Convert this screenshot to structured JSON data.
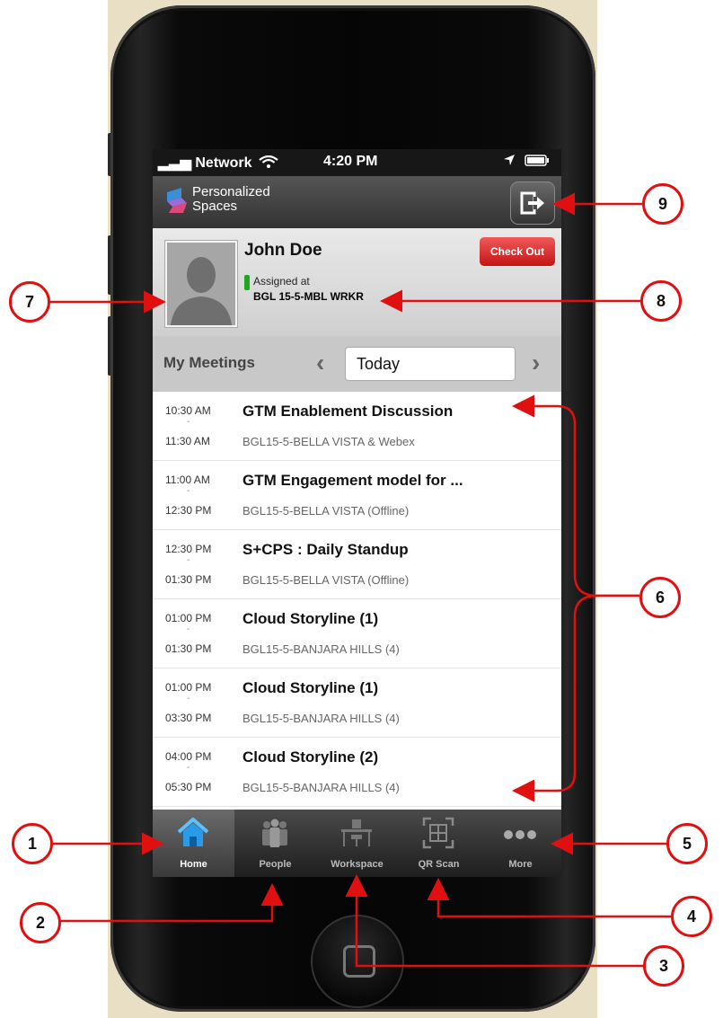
{
  "status_bar": {
    "network": "Network",
    "time": "4:20 PM"
  },
  "app": {
    "name_line1": "Personalized",
    "name_line2": "Spaces"
  },
  "profile": {
    "name": "John Doe",
    "assigned_label": "Assigned at",
    "assigned_value": "BGL 15-5-MBL WRKR",
    "checkout_label": "Check Out"
  },
  "meetings_header": {
    "title": "My Meetings",
    "date_value": "Today"
  },
  "meetings": [
    {
      "start": "10:30 AM",
      "end": "11:30 AM",
      "title": "GTM Enablement Discussion",
      "location": "BGL15-5-BELLA VISTA & Webex"
    },
    {
      "start": "11:00 AM",
      "end": "12:30 PM",
      "title": "GTM Engagement model for ...",
      "location": "BGL15-5-BELLA VISTA (Offline)"
    },
    {
      "start": "12:30 PM",
      "end": "01:30 PM",
      "title": "S+CPS : Daily Standup",
      "location": "BGL15-5-BELLA VISTA (Offline)"
    },
    {
      "start": "01:00 PM",
      "end": "01:30 PM",
      "title": "Cloud Storyline (1)",
      "location": "BGL15-5-BANJARA HILLS (4)"
    },
    {
      "start": "01:00 PM",
      "end": "03:30 PM",
      "title": "Cloud Storyline (1)",
      "location": "BGL15-5-BANJARA HILLS (4)"
    },
    {
      "start": "04:00 PM",
      "end": "05:30 PM",
      "title": "Cloud Storyline (2)",
      "location": "BGL15-5-BANJARA HILLS (4)"
    }
  ],
  "tabs": [
    {
      "label": "Home",
      "icon": "home-icon",
      "active": true
    },
    {
      "label": "People",
      "icon": "people-icon",
      "active": false
    },
    {
      "label": "Workspace",
      "icon": "workspace-icon",
      "active": false
    },
    {
      "label": "QR Scan",
      "icon": "qr-scan-icon",
      "active": false
    },
    {
      "label": "More",
      "icon": "more-icon",
      "active": false
    }
  ],
  "callouts": [
    "1",
    "2",
    "3",
    "4",
    "5",
    "6",
    "7",
    "8",
    "9"
  ],
  "colors": {
    "accent_red": "#e01010",
    "checkout_red": "#d42020",
    "home_blue": "#2a9be8",
    "status_green": "#1fa81f"
  }
}
